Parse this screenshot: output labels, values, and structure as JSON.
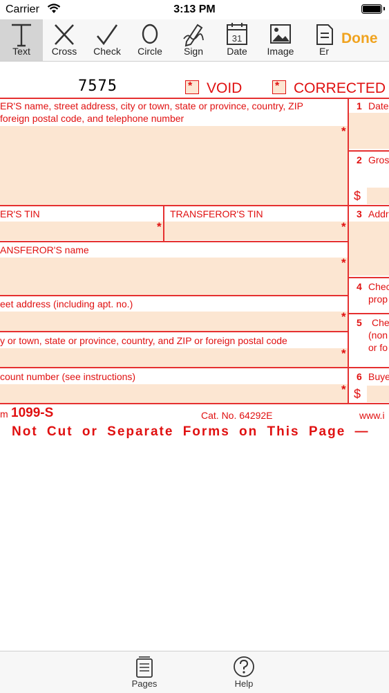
{
  "status": {
    "carrier": "Carrier",
    "time": "3:13 PM"
  },
  "toolbar": {
    "tools": [
      {
        "label": "Text",
        "icon": "text-icon"
      },
      {
        "label": "Cross",
        "icon": "cross-icon"
      },
      {
        "label": "Check",
        "icon": "check-icon"
      },
      {
        "label": "Circle",
        "icon": "circle-icon"
      },
      {
        "label": "Sign",
        "icon": "sign-icon"
      },
      {
        "label": "Date",
        "icon": "calendar-icon",
        "calendar_day": "31"
      },
      {
        "label": "Image",
        "icon": "image-icon"
      },
      {
        "label": "Er",
        "icon": "eraser-icon"
      }
    ],
    "done_label": "Done",
    "active_tool": "Text"
  },
  "form": {
    "code": "7575",
    "void_label": "VOID",
    "corrected_label": "CORRECTED",
    "checkbox_mark": "*",
    "field_mark": "*",
    "filer_line1": "ER'S name, street address, city or town, state or province, country, ZIP",
    "filer_line2": "foreign postal code, and telephone number",
    "filer_tin": "ER'S TIN",
    "transferor_tin": "TRANSFEROR'S TIN",
    "transferor_name": "ANSFEROR'S name",
    "street_address": "eet address (including apt. no.)",
    "city_line": "y or town, state or province, country, and ZIP or foreign postal code",
    "account_number": "count number (see instructions)",
    "box1": {
      "num": "1",
      "label": "Date"
    },
    "box2": {
      "num": "2",
      "label": "Gros"
    },
    "box3": {
      "num": "3",
      "label": "Addr"
    },
    "box4": {
      "num": "4",
      "label1": "Chec",
      "label2": "prop"
    },
    "box5": {
      "num": "5",
      "label1": "Che",
      "label2": "(non",
      "label3": "or fo"
    },
    "box6": {
      "num": "6",
      "label": "Buye"
    },
    "dollar": "$",
    "form_prefix": "m",
    "form_name": "1099-S",
    "cat_no": "Cat. No. 64292E",
    "website": "www.i",
    "notice": "Not Cut or Separate Forms on This Page —"
  },
  "tabbar": {
    "tabs": [
      {
        "label": "Pages",
        "icon": "pages-icon"
      },
      {
        "label": "Help",
        "icon": "help-icon"
      }
    ]
  },
  "colors": {
    "form_red": "#e01010",
    "field_fill": "#fce6d2",
    "done_orange": "#f0a31f"
  }
}
